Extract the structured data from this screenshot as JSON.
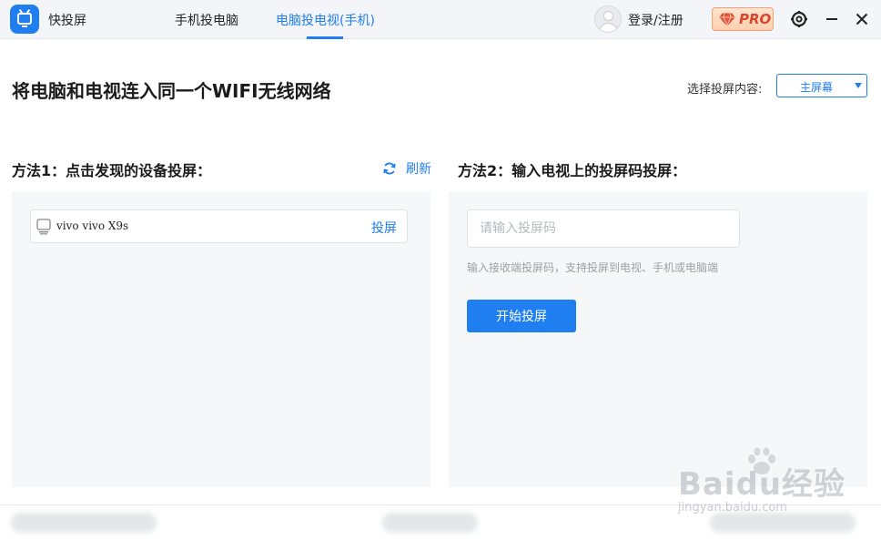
{
  "titlebar": {
    "app_name": "快投屏",
    "tabs": [
      {
        "label": "手机投电脑",
        "active": false
      },
      {
        "label": "电脑投电视(手机)",
        "active": true
      }
    ],
    "login_label": "登录/注册",
    "pro_label": "PRO",
    "icons": [
      "app-logo-icon",
      "avatar-icon",
      "diamond-icon",
      "settings-icon",
      "minimize-icon",
      "close-icon"
    ]
  },
  "main": {
    "title": "将电脑和电视连入同一个WIFI无线网络",
    "select_label": "选择投屏内容:",
    "select_value": "主屏幕"
  },
  "method1": {
    "title": "方法1：点击发现的设备投屏：",
    "refresh_label": "刷新",
    "devices": [
      {
        "name": "vivo vivo X9s",
        "action": "投屏"
      }
    ]
  },
  "method2": {
    "title": "方法2：输入电视上的投屏码投屏：",
    "input_placeholder": "请输入投屏码",
    "hint": "输入接收端投屏码，支持投屏到电视、手机或电脑端",
    "start_button": "开始投屏"
  },
  "watermark": {
    "main": "Baidu经验",
    "sub": "jingyan.baidu.com"
  },
  "colors": {
    "accent": "#1f7ef0",
    "titlebar_bg": "#f3f5f8",
    "panel_bg": "#f6f7f9",
    "pro_text": "#d6472b"
  }
}
